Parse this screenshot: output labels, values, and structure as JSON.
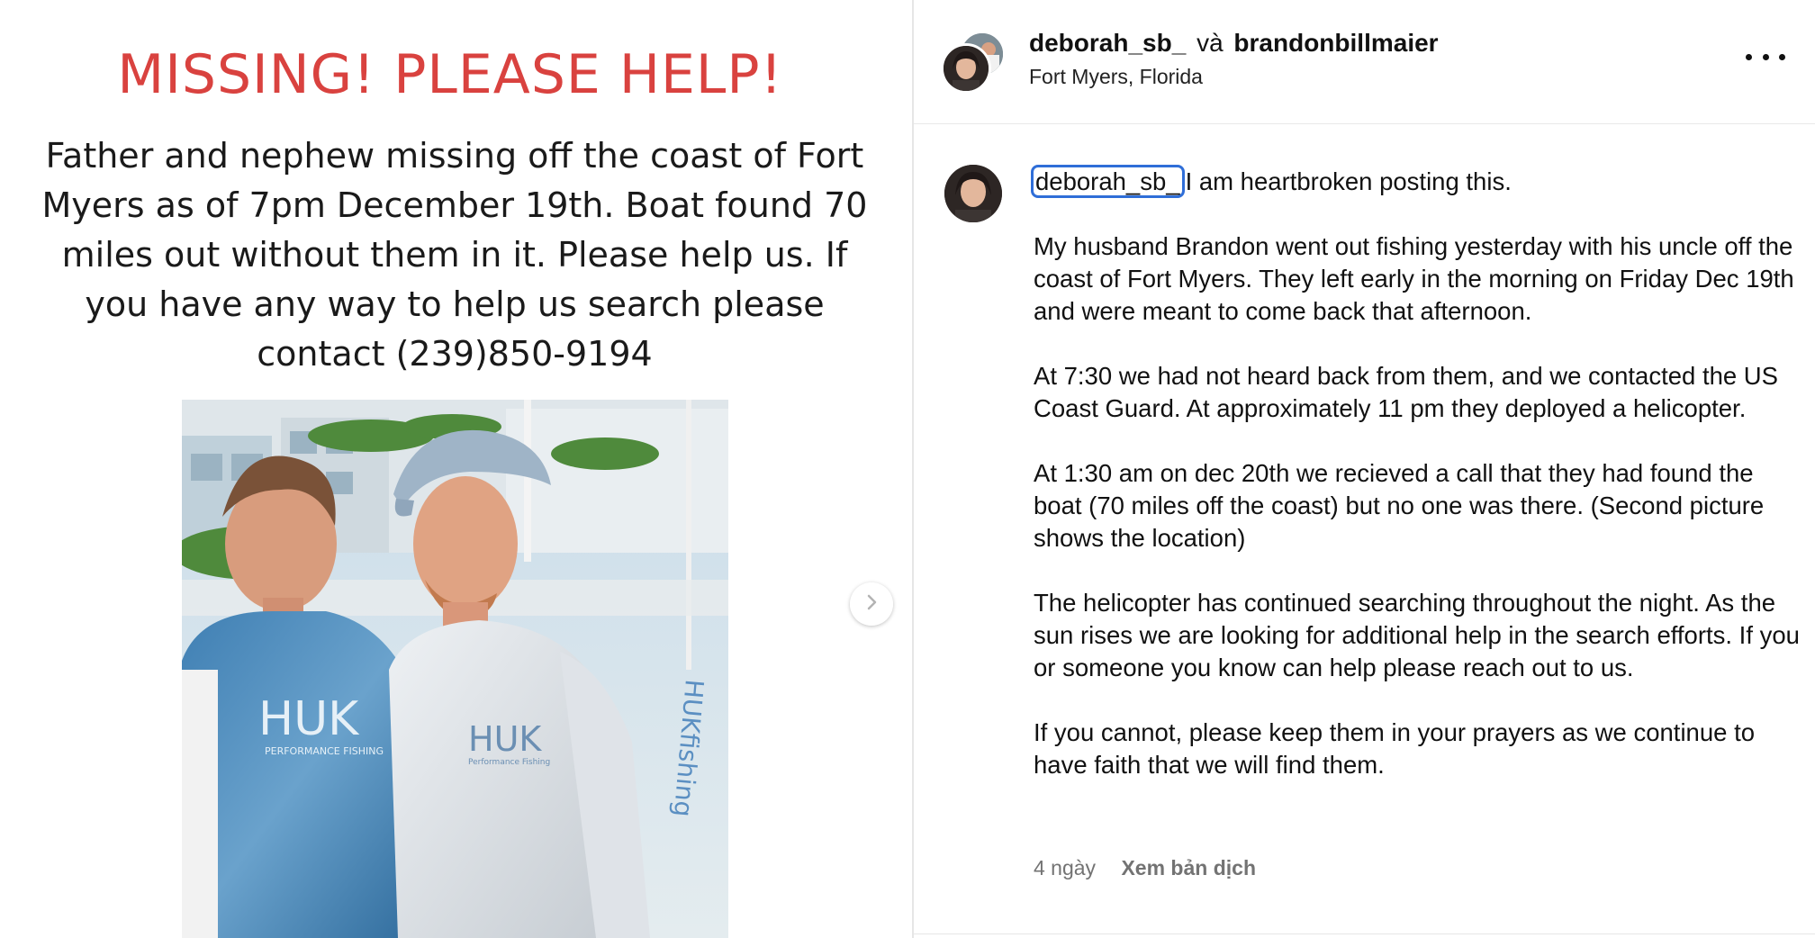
{
  "poster": {
    "title": "MISSING! PLEASE HELP!",
    "body": "Father and nephew missing off the coast of Fort Myers as of 7pm December 19th. Boat found 70 miles out without them in it. Please help us. If you have any way to help us search please contact (239)850-9194",
    "shirt_brand_left": "HUK",
    "shirt_sub_left": "PERFORMANCE FISHING",
    "shirt_brand_right": "HUK",
    "shirt_sub_right": "Performance Fishing",
    "sleeve_text": "HUKfishing"
  },
  "header": {
    "user1": "deborah_sb_",
    "conjunction": "và",
    "user2": "brandonbillmaier",
    "location": "Fort Myers, Florida"
  },
  "caption": {
    "mention": "deborah_sb_",
    "first_line": "I am heartbroken posting this.",
    "paragraphs": [
      "My husband Brandon went out fishing yesterday with his uncle off the coast of Fort Myers. They left early in the morning on Friday Dec 19th and were meant to come back that afternoon.",
      "At 7:30 we had not heard back from them, and we contacted the US Coast Guard. At approximately 11 pm they deployed a helicopter.",
      "At 1:30 am on dec 20th we recieved a call that they had found the boat (70 miles off the coast) but no one was there. (Second picture shows the location)",
      "The helicopter has continued searching throughout the night. As the sun rises we are looking for additional help in the search efforts. If you or someone you know can help please reach out to us.",
      "If you cannot, please keep them in your prayers as we continue to have faith that we will find them."
    ]
  },
  "meta": {
    "age": "4 ngày",
    "translate": "Xem bản dịch"
  },
  "icons": [
    "chevron-right-icon",
    "more-horizontal-icon"
  ],
  "colors": {
    "poster_title": "#d9423f",
    "mention_outline": "#2f6ed8",
    "meta_text": "#737373"
  }
}
